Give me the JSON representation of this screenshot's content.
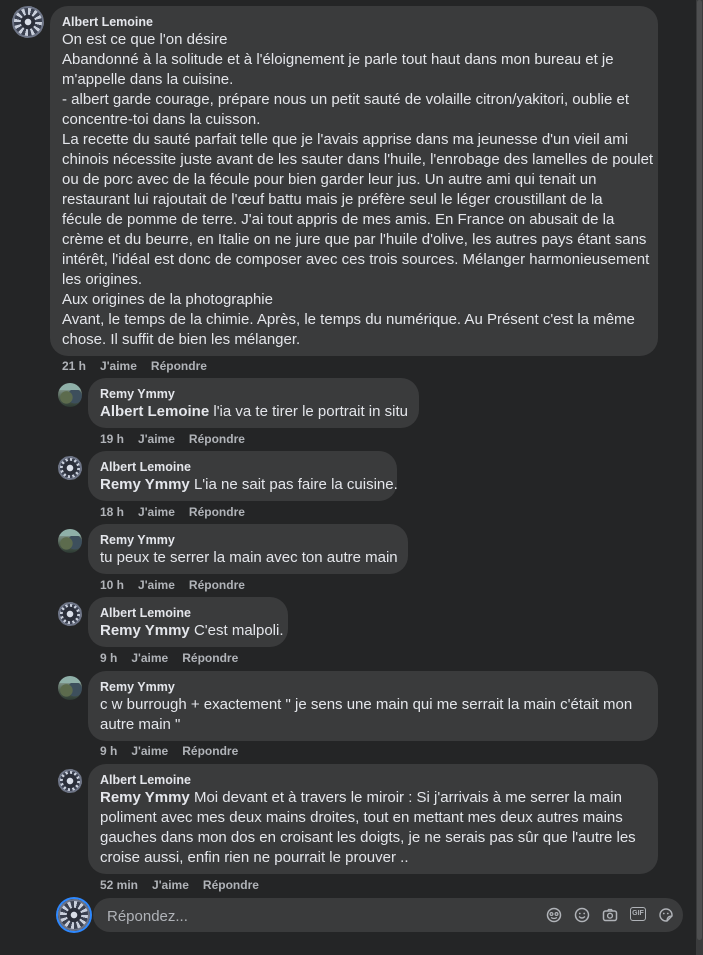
{
  "comments": [
    {
      "author": "Albert Lemoine",
      "lines": [
        "On est ce que l'on désire",
        "Abandonné à la solitude et à l'éloignement je parle tout haut dans mon bureau et je",
        "m'appelle dans la cuisine.",
        "- albert garde courage, prépare nous un petit sauté de volaille citron/yakitori, oublie et",
        "concentre-toi dans la cuisson.",
        "La recette du sauté parfait telle que je l'avais apprise dans ma jeunesse d'un vieil ami",
        "chinois nécessite juste avant de les sauter dans l'huile, l'enrobage des lamelles de poulet",
        "ou de porc avec de la fécule pour bien garder leur jus. Un autre ami qui tenait un",
        "restaurant lui rajoutait de l'œuf battu mais je préfère seul le léger croustillant de la",
        "fécule de pomme de terre. J'ai tout appris de mes amis. En France on abusait de la",
        "crème et du beurre, en Italie on ne jure que par l'huile d'olive, les autres pays étant sans",
        "intérêt, l'idéal est donc de composer avec ces trois sources. Mélanger harmonieusement",
        "les origines.",
        "Aux origines de la photographie",
        "Avant, le temps de la chimie. Après, le temps du numérique. Au Présent c'est la même",
        "chose. Il suffit de bien les mélanger."
      ],
      "time": "21 h",
      "like": "J'aime",
      "reply": "Répondre"
    }
  ],
  "replies": [
    {
      "author": "Remy Ymmy",
      "mention": "Albert Lemoine",
      "lines": [
        "l'ia va te tirer le portrait in situ"
      ],
      "time": "19 h",
      "like": "J'aime",
      "reply": "Répondre"
    },
    {
      "author": "Albert Lemoine",
      "mention": "Remy Ymmy",
      "lines": [
        "L'ia ne sait pas faire la cuisine."
      ],
      "time": "18 h",
      "like": "J'aime",
      "reply": "Répondre"
    },
    {
      "author": "Remy Ymmy",
      "mention": "",
      "lines": [
        "tu peux te serrer la main avec ton autre main"
      ],
      "time": "10 h",
      "like": "J'aime",
      "reply": "Répondre"
    },
    {
      "author": "Albert Lemoine",
      "mention": "Remy Ymmy",
      "lines": [
        "C'est malpoli."
      ],
      "time": "9 h",
      "like": "J'aime",
      "reply": "Répondre"
    },
    {
      "author": "Remy Ymmy",
      "mention": "",
      "lines": [
        "c w burrough + exactement \" je sens une main qui me serrait la main c'était mon",
        "autre main \""
      ],
      "time": "9 h",
      "like": "J'aime",
      "reply": "Répondre"
    },
    {
      "author": "Albert Lemoine",
      "mention": "Remy Ymmy",
      "lines": [
        "Moi devant et à travers le miroir : Si j'arrivais à me serrer la main",
        "poliment avec mes deux mains droites, tout en mettant mes deux autres mains",
        "gauches dans mon dos en croisant les doigts, je ne serais pas sûr que l'autre les",
        "croise aussi, enfin rien ne pourrait le prouver .."
      ],
      "time": "52 min",
      "like": "J'aime",
      "reply": "Répondre"
    }
  ],
  "composer": {
    "placeholder": "Répondez...",
    "icons": [
      "avatar-sticker-icon",
      "emoji-icon",
      "camera-icon",
      "gif-icon",
      "sticker-icon"
    ]
  }
}
